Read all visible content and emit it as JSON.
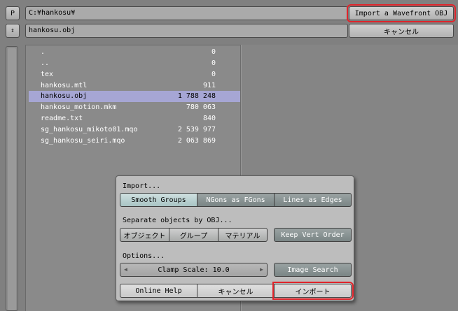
{
  "header": {
    "p_button_label": "P",
    "path_value": "C:¥hankosu¥",
    "import_button_label": "Import a Wavefront OBJ",
    "sort_toggle_glyph": "⇕",
    "filename_value": "hankosu.obj",
    "cancel_button_label": "キャンセル"
  },
  "files": [
    {
      "name": ".",
      "size": "0"
    },
    {
      "name": "..",
      "size": "0"
    },
    {
      "name": "tex",
      "size": "0"
    },
    {
      "name": "hankosu.mtl",
      "size": "911"
    },
    {
      "name": "hankosu.obj",
      "size": "1 788 248"
    },
    {
      "name": "hankosu_motion.mkm",
      "size": "780 063"
    },
    {
      "name": "readme.txt",
      "size": "840"
    },
    {
      "name": "sg_hankosu_mikoto01.mqo",
      "size": "2 539 977"
    },
    {
      "name": "sg_hankosu_seiri.mqo",
      "size": "2 063 869"
    }
  ],
  "dialog": {
    "import_label": "Import...",
    "smooth_groups": "Smooth Groups",
    "ngons": "NGons as FGons",
    "lines_as_edges": "Lines as Edges",
    "separate_label": "Separate objects by OBJ...",
    "object_btn": "オブジェクト",
    "group_btn": "グループ",
    "material_btn": "マテリアル",
    "keep_vert_order": "Keep Vert Order",
    "options_label": "Options...",
    "clamp_scale": "Clamp Scale: 10.0",
    "image_search": "Image Search",
    "online_help": "Online Help",
    "cancel": "キャンセル",
    "import_btn": "インポート"
  }
}
